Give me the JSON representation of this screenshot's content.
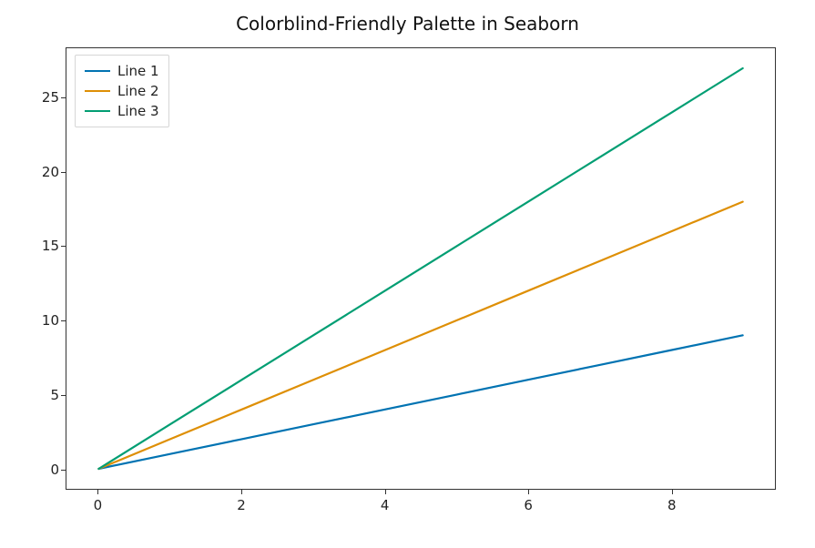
{
  "chart_data": {
    "type": "line",
    "title": "Colorblind-Friendly Palette in Seaborn",
    "xlabel": "",
    "ylabel": "",
    "xlim": [
      -0.45,
      9.45
    ],
    "ylim": [
      -1.35,
      28.35
    ],
    "x": [
      0,
      1,
      2,
      3,
      4,
      5,
      6,
      7,
      8,
      9
    ],
    "series": [
      {
        "name": "Line 1",
        "color": "#0173b2",
        "values": [
          0,
          1,
          2,
          3,
          4,
          5,
          6,
          7,
          8,
          9
        ]
      },
      {
        "name": "Line 2",
        "color": "#de8f05",
        "values": [
          0,
          2,
          4,
          6,
          8,
          10,
          12,
          14,
          16,
          18
        ]
      },
      {
        "name": "Line 3",
        "color": "#029e73",
        "values": [
          0,
          3,
          6,
          9,
          12,
          15,
          18,
          21,
          24,
          27
        ]
      }
    ],
    "x_ticks": [
      0,
      2,
      4,
      6,
      8
    ],
    "y_ticks": [
      0,
      5,
      10,
      15,
      20,
      25
    ],
    "legend_position": "upper left",
    "grid": false
  }
}
